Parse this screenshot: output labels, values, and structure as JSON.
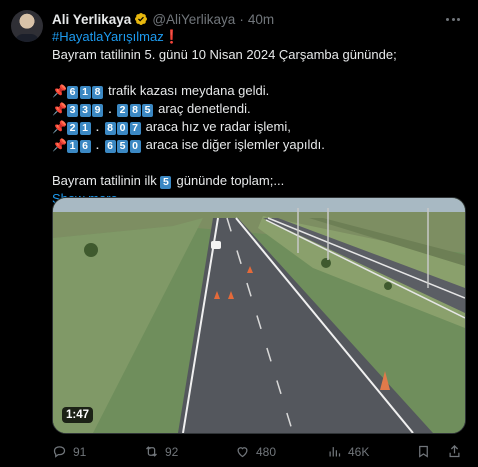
{
  "tweet": {
    "author_name": "Ali Yerlikaya",
    "handle": "@AliYerlikaya",
    "separator": "·",
    "time": "40m",
    "hashtag": "#HayatlaYarışılmaz",
    "exclamation": "❗",
    "line1": "Bayram tatilinin 5. günü 10 Nisan 2024 Çarşamba gününde;",
    "stats": [
      {
        "icon": "pushpin-icon",
        "number": [
          "6",
          "1",
          "8"
        ],
        "text": " trafik kazası meydana geldi."
      },
      {
        "icon": "pushpin-icon",
        "number": [
          "3",
          "3",
          "9",
          ".",
          "2",
          "8",
          "5"
        ],
        "text": " araç denetlendi."
      },
      {
        "icon": "pushpin-icon",
        "number": [
          "2",
          "1",
          ".",
          "8",
          "0",
          "7"
        ],
        "text": " araca hız ve radar işlemi,"
      },
      {
        "icon": "pushpin-icon",
        "number": [
          "1",
          "6",
          ".",
          "6",
          "5",
          "0"
        ],
        "text": " araca ise diğer işlemler yapıldı."
      }
    ],
    "summary_pre": "Bayram tatilinin ilk ",
    "summary_num": "5",
    "summary_post": " gününde toplam;...",
    "show_more": "Show more"
  },
  "media": {
    "duration": "1:47",
    "colors": {
      "grass": "#6d8a5a",
      "road": "#5a5d63",
      "sky": "#9fb4c6"
    }
  },
  "actions": {
    "reply_count": "91",
    "retweet_count": "92",
    "like_count": "480",
    "view_count": "46K"
  },
  "colors": {
    "accent": "#1d9bf0",
    "muted": "#71767b",
    "keycap": "#3b88c3"
  }
}
